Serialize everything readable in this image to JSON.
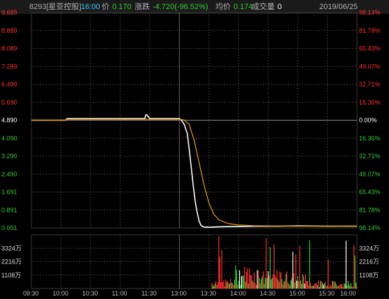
{
  "header": {
    "code_name": "8293[星亚控股]",
    "time": "16:00",
    "price_label": "价",
    "price": "0.170",
    "change_label": "涨跌",
    "change": "-4.720(-96.52%)",
    "avg_label": "均价",
    "avg": "0.174",
    "volume_label": "成交量",
    "volume": "0",
    "date": "2019/06/25"
  },
  "colors": {
    "up": "#ff3030",
    "down": "#33cc33",
    "neutral": "#ffffff",
    "price_line": "#ffffff",
    "avg_line": "#e8a000",
    "grid": "#3a3a3a",
    "header_time": "#33ccff"
  },
  "chart_data": {
    "type": "line",
    "y_left_labels": [
      "9.689",
      "8.889",
      "8.089",
      "7.289",
      "6.490",
      "5.690",
      "4.890",
      "4.090",
      "3.290",
      "2.490",
      "1.691",
      "0.891",
      "0.091"
    ],
    "y_right_labels": [
      "98.14%",
      "81.78%",
      "65.43%",
      "49.07%",
      "32.71%",
      "16.36%",
      "0.00%",
      "16.36%",
      "32.71%",
      "49.07%",
      "65.43%",
      "81.78%",
      "98.14%"
    ],
    "ylim": [
      0.091,
      9.689
    ],
    "prev_close": 4.89,
    "x_labels": [
      "09:30",
      "10:00",
      "10:30",
      "11:00",
      "11:30",
      "13:00",
      "13:30",
      "14:00",
      "14:30",
      "15:00",
      "15:30",
      "16:00"
    ],
    "series": [
      {
        "id": "price",
        "x": [
          "09:30",
          "10:05",
          "10:06",
          "11:25",
          "11:26",
          "11:27",
          "11:30",
          "13:00",
          "13:02",
          "13:05",
          "13:08",
          "13:10",
          "13:12",
          "13:14",
          "13:16",
          "13:18",
          "13:20",
          "13:22",
          "13:24",
          "13:26",
          "13:28",
          "13:30",
          "13:35",
          "13:40",
          "14:00",
          "14:20",
          "14:40",
          "15:00",
          "15:30",
          "16:00"
        ],
        "y": [
          4.89,
          4.89,
          4.96,
          4.96,
          5.13,
          5.13,
          4.96,
          4.96,
          4.9,
          4.7,
          4.3,
          3.6,
          2.8,
          2.0,
          1.3,
          0.8,
          0.4,
          0.2,
          0.15,
          0.12,
          0.13,
          0.12,
          0.13,
          0.14,
          0.16,
          0.17,
          0.17,
          0.18,
          0.17,
          0.17
        ]
      },
      {
        "id": "avg",
        "x": [
          "09:30",
          "10:05",
          "10:06",
          "11:30",
          "13:00",
          "13:05",
          "13:10",
          "13:15",
          "13:20",
          "13:25",
          "13:30",
          "13:35",
          "13:40",
          "13:50",
          "14:00",
          "14:15",
          "14:30",
          "15:00",
          "15:30",
          "16:00"
        ],
        "y": [
          4.89,
          4.89,
          4.93,
          4.93,
          4.93,
          4.9,
          4.7,
          4.0,
          3.0,
          2.0,
          1.2,
          0.7,
          0.45,
          0.28,
          0.22,
          0.19,
          0.18,
          0.17,
          0.17,
          0.174
        ]
      }
    ],
    "volume": {
      "y_labels": [
        "3324万",
        "2216万",
        "1108万"
      ],
      "ylim": [
        0,
        4432
      ],
      "unit": "万",
      "x_start": "13:33",
      "x_end": "16:00",
      "step_minutes": 1
    }
  }
}
